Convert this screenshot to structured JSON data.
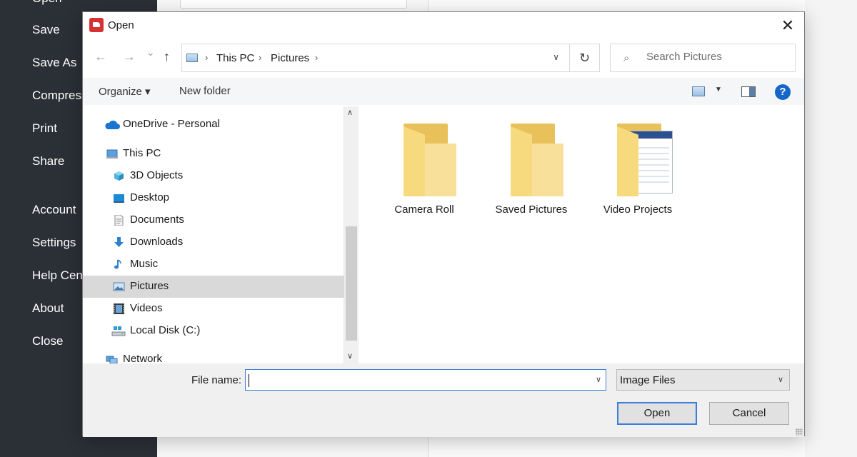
{
  "app": {
    "menu": [
      "Open",
      "Save",
      "Save As",
      "Compress",
      "Print",
      "Share",
      "Account",
      "Settings",
      "Help Center",
      "About",
      "Close"
    ]
  },
  "dialog": {
    "title": "Open",
    "close_glyph": "✕",
    "nav": {
      "back": "←",
      "forward": "→",
      "recent": "⌄",
      "up": "↑"
    },
    "breadcrumb": [
      "This PC",
      "Pictures"
    ],
    "breadcrumb_sep": "›",
    "refresh_glyph": "↻",
    "search_placeholder": "Search Pictures",
    "toolbar": {
      "organize": "Organize ▾",
      "new_folder": "New folder",
      "help": "?"
    },
    "nav_pane": [
      {
        "label": "OneDrive - Personal",
        "icon": "cloud-icon",
        "level": 0
      },
      {
        "label": "This PC",
        "icon": "computer-icon",
        "level": 0
      },
      {
        "label": "3D Objects",
        "icon": "cube-icon",
        "level": 1
      },
      {
        "label": "Desktop",
        "icon": "desktop-icon",
        "level": 1
      },
      {
        "label": "Documents",
        "icon": "document-icon",
        "level": 1
      },
      {
        "label": "Downloads",
        "icon": "download-arrow-icon",
        "level": 1
      },
      {
        "label": "Music",
        "icon": "music-note-icon",
        "level": 1
      },
      {
        "label": "Pictures",
        "icon": "pictures-icon",
        "level": 1,
        "selected": true
      },
      {
        "label": "Videos",
        "icon": "film-icon",
        "level": 1
      },
      {
        "label": "Local Disk (C:)",
        "icon": "drive-icon",
        "level": 1
      },
      {
        "label": "Network",
        "icon": "network-icon",
        "level": 0
      }
    ],
    "folders": [
      {
        "label": "Camera Roll",
        "icon": "folder-icon"
      },
      {
        "label": "Saved Pictures",
        "icon": "folder-icon"
      },
      {
        "label": "Video Projects",
        "icon": "folder-with-preview-icon"
      }
    ],
    "footer": {
      "file_name_label": "File name:",
      "file_name_value": "",
      "file_type": "Image Files",
      "open_label": "Open",
      "cancel_label": "Cancel"
    }
  }
}
